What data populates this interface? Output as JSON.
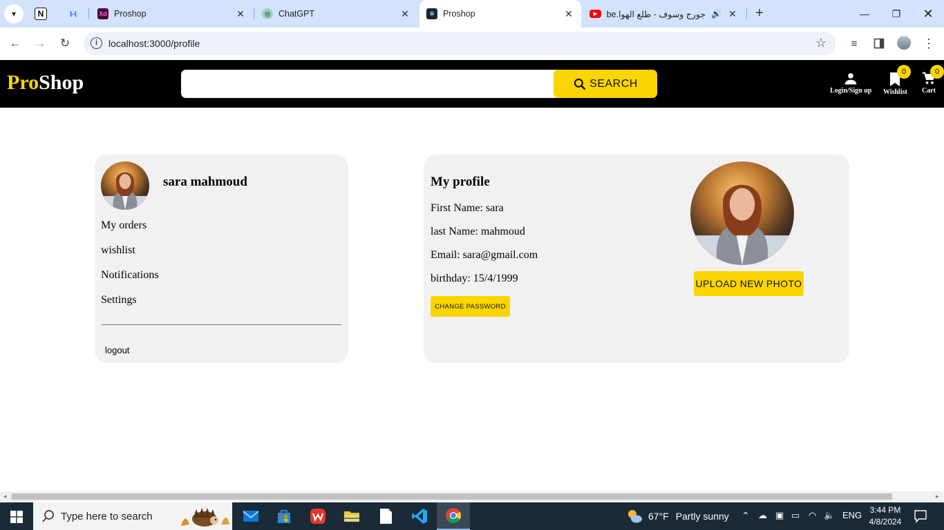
{
  "browser": {
    "tabs": [
      {
        "title": "Proshop",
        "icon": "adobe-xd-icon"
      },
      {
        "title": "ChatGPT",
        "icon": "openai-icon"
      },
      {
        "title": "Proshop",
        "icon": "react-icon",
        "active": true
      },
      {
        "title": "جورج وسوف - طلع الهوا.ube",
        "icon": "youtube-icon"
      }
    ],
    "url": "localhost:3000/profile"
  },
  "header": {
    "logo_part1": "Pro",
    "logo_part2": "Shop",
    "search_placeholder": "",
    "search_label": "SEARCH",
    "login_label": "Login/Sign up",
    "wishlist_label": "Wishlist",
    "wishlist_count": "0",
    "cart_label": "Cart",
    "cart_count": "0"
  },
  "sidebar": {
    "username": "sara mahmoud",
    "links": [
      "My orders",
      "wishlist",
      "Notifications",
      "Settings"
    ],
    "logout": "logout"
  },
  "profile": {
    "title": "My profile",
    "first_name": "First Name: sara",
    "last_name": "last Name: mahmoud",
    "email": "Email: sara@gmail.com",
    "birthday": "birthday: 15/4/1999",
    "change_password": "CHANGE PASSWORD",
    "upload_photo": "UPLOAD NEW PHOTO"
  },
  "taskbar": {
    "search_placeholder": "Type here to search",
    "weather_temp": "67°F",
    "weather_desc": "Partly sunny",
    "language": "ENG",
    "time": "3:44 PM",
    "date": "4/8/2024"
  },
  "colors": {
    "accent": "#fcd500",
    "header_bg": "#000000",
    "card_bg": "#f1f1f1",
    "tabstrip_bg": "#d3e3fd"
  }
}
